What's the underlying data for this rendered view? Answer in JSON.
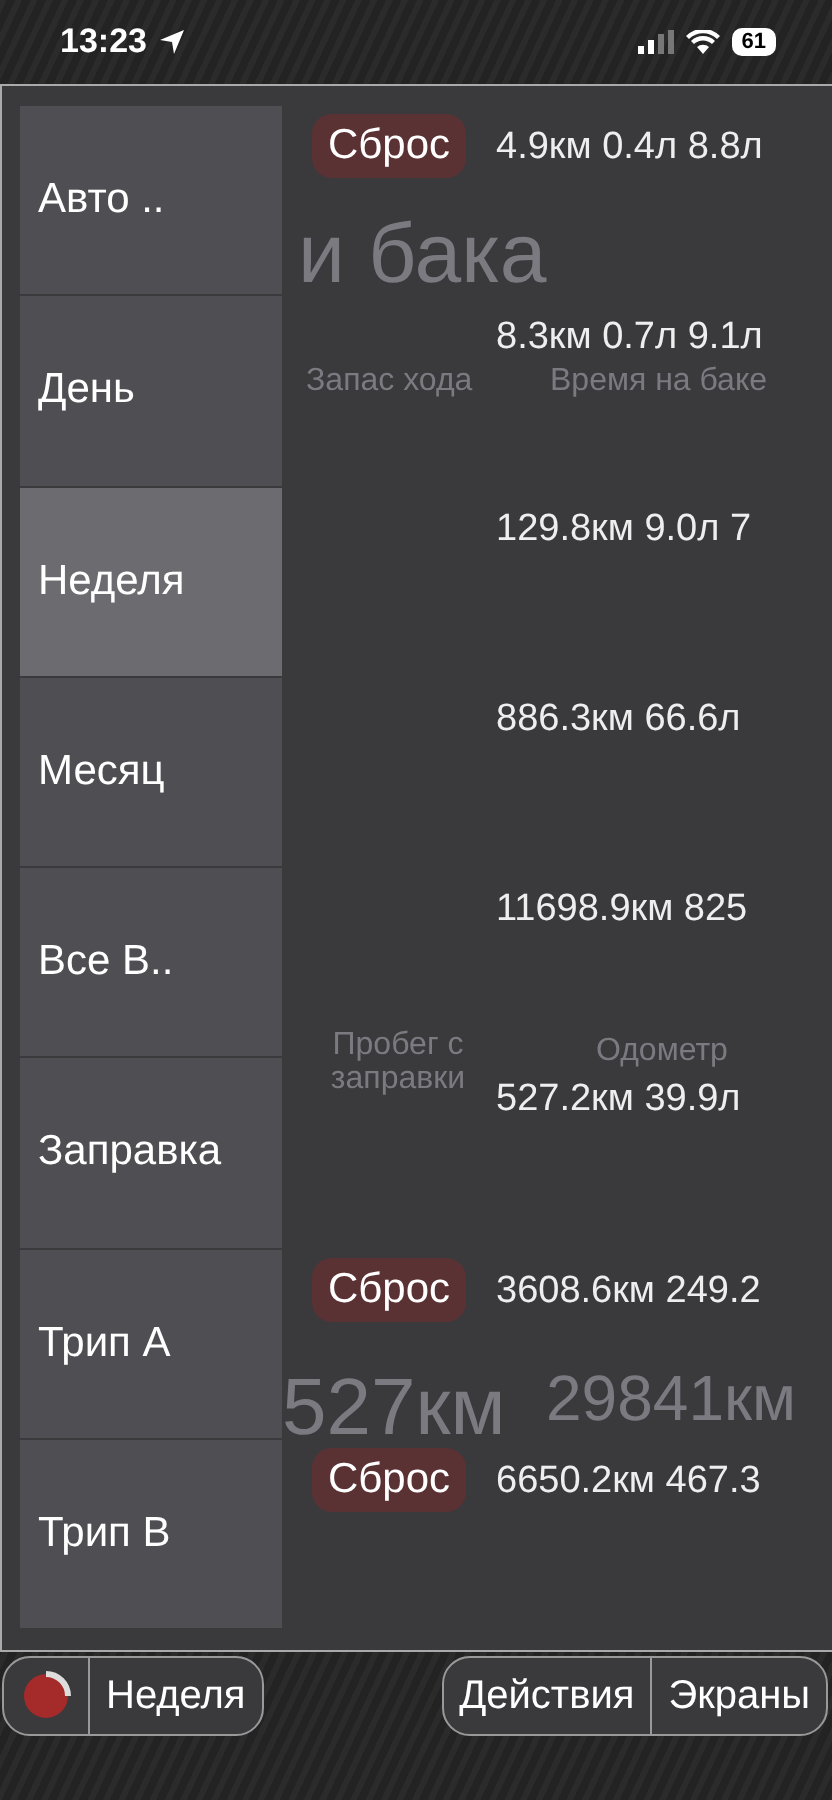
{
  "status_bar": {
    "time": "13:23",
    "battery": "61"
  },
  "background_labels": [
    {
      "kind": "title",
      "text": "и бака"
    },
    {
      "kind": "range",
      "text": "Запас хода"
    },
    {
      "kind": "tank_time",
      "text": "Время на баке"
    },
    {
      "kind": "since_refuel",
      "text": "Пробег с заправки"
    },
    {
      "kind": "odometer",
      "text": "Одометр"
    },
    {
      "kind": "big_refuel",
      "text": "527км"
    },
    {
      "kind": "big_odometer",
      "text": "29841км"
    }
  ],
  "menu": [
    {
      "label": "Авто ..",
      "selected": false
    },
    {
      "label": "День",
      "selected": false
    },
    {
      "label": "Неделя",
      "selected": true
    },
    {
      "label": "Месяц",
      "selected": false
    },
    {
      "label": "Все В..",
      "selected": false
    },
    {
      "label": "Заправка",
      "selected": false
    },
    {
      "label": "Трип A",
      "selected": false
    },
    {
      "label": "Трип B",
      "selected": false
    }
  ],
  "rows": [
    {
      "kind": "reset",
      "button": "Сброс",
      "stats": "4.9км 0.4л 8.8л"
    },
    {
      "kind": "plain",
      "stats": "8.3км 0.7л 9.1л"
    },
    {
      "kind": "plain",
      "stats": "129.8км 9.0л 7"
    },
    {
      "kind": "plain",
      "stats": "886.3км 66.6л"
    },
    {
      "kind": "plain",
      "stats": "11698.9км 825"
    },
    {
      "kind": "plain",
      "stats": "527.2км 39.9л"
    },
    {
      "kind": "reset",
      "button": "Сброс",
      "stats": "3608.6км 249.2"
    },
    {
      "kind": "reset",
      "button": "Сброс",
      "stats": "6650.2км 467.3"
    }
  ],
  "bottom_bar": {
    "period": "Неделя",
    "actions": [
      "Действия",
      "Экраны"
    ]
  }
}
